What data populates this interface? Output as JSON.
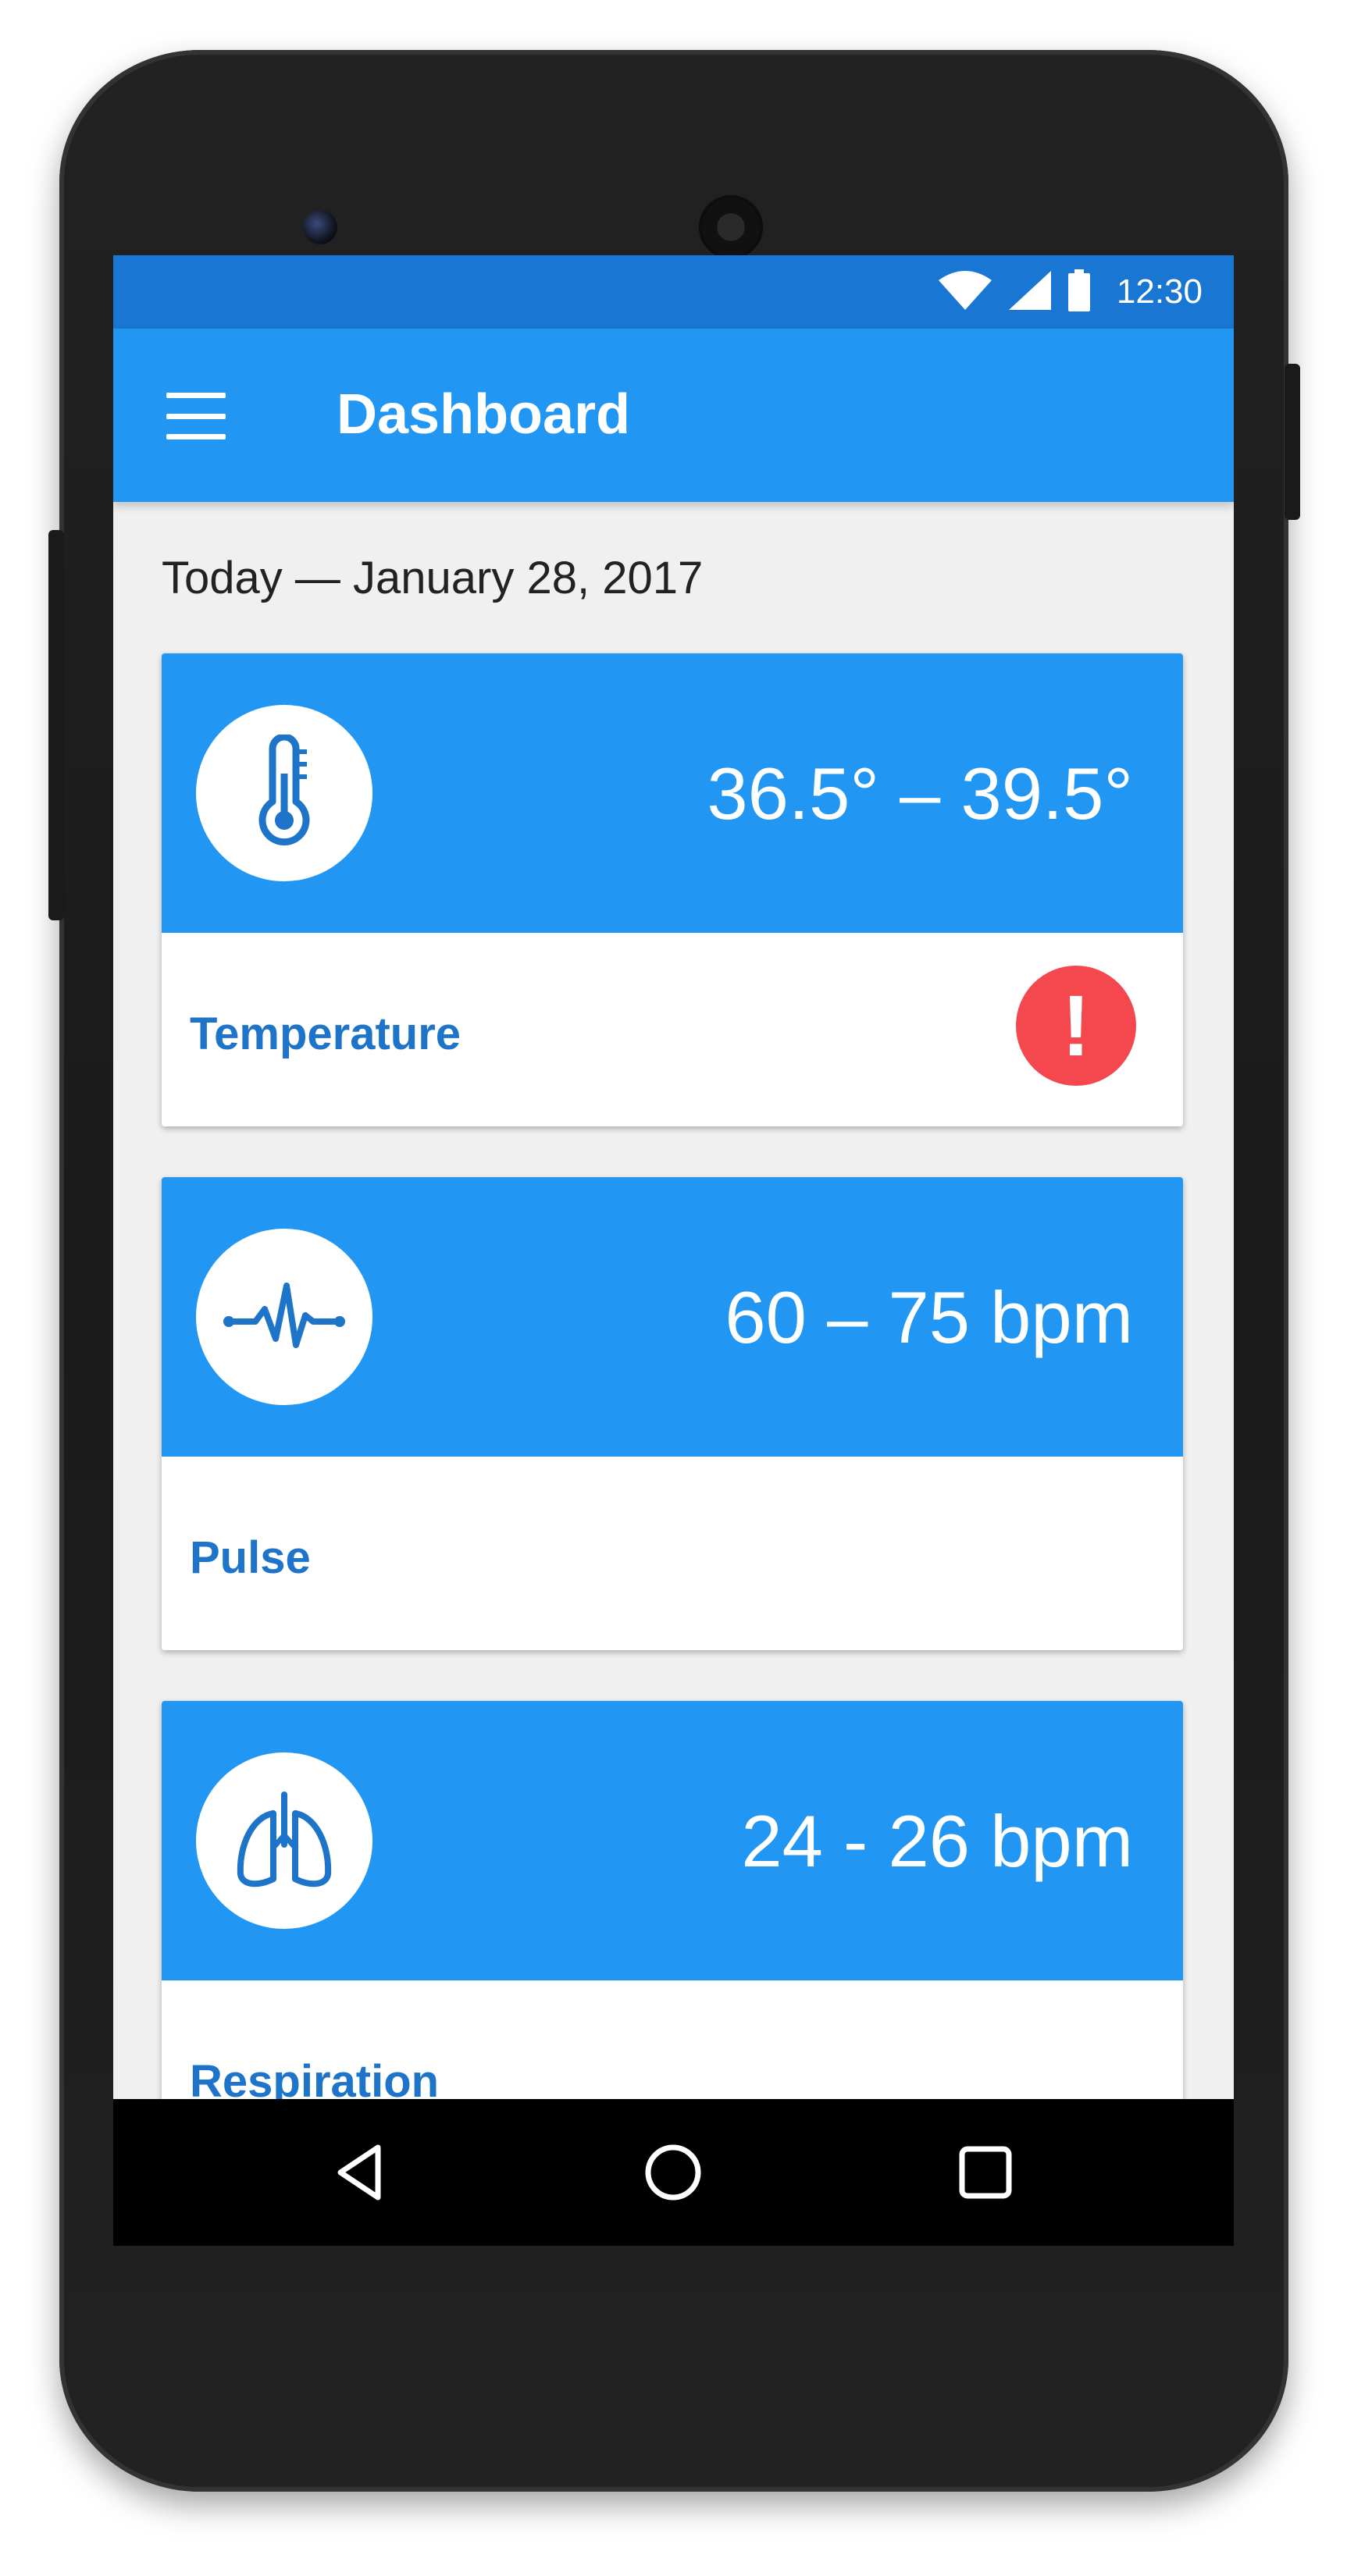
{
  "status_bar": {
    "time": "12:30",
    "icons": [
      "wifi-icon",
      "signal-icon",
      "battery-icon"
    ]
  },
  "app_bar": {
    "title": "Dashboard",
    "menu_icon": "hamburger-menu-icon"
  },
  "date_label": "Today — January 28, 2017",
  "cards": [
    {
      "label": "Temperature",
      "value": "36.5° – 39.5°",
      "icon": "thermometer-icon",
      "alert": true,
      "alert_symbol": "!"
    },
    {
      "label": "Pulse",
      "value": "60 – 75 bpm",
      "icon": "heartbeat-icon",
      "alert": false
    },
    {
      "label": "Respiration",
      "value": "24 - 26 bpm",
      "icon": "lungs-icon",
      "alert": false
    }
  ],
  "nav_bar": {
    "buttons": [
      "back-icon",
      "home-icon",
      "recents-icon"
    ]
  },
  "colors": {
    "status_bar": "#1976d2",
    "primary": "#2196f3",
    "label_text": "#1e74c8",
    "alert": "#f4474e",
    "background": "#f0f0f0"
  }
}
